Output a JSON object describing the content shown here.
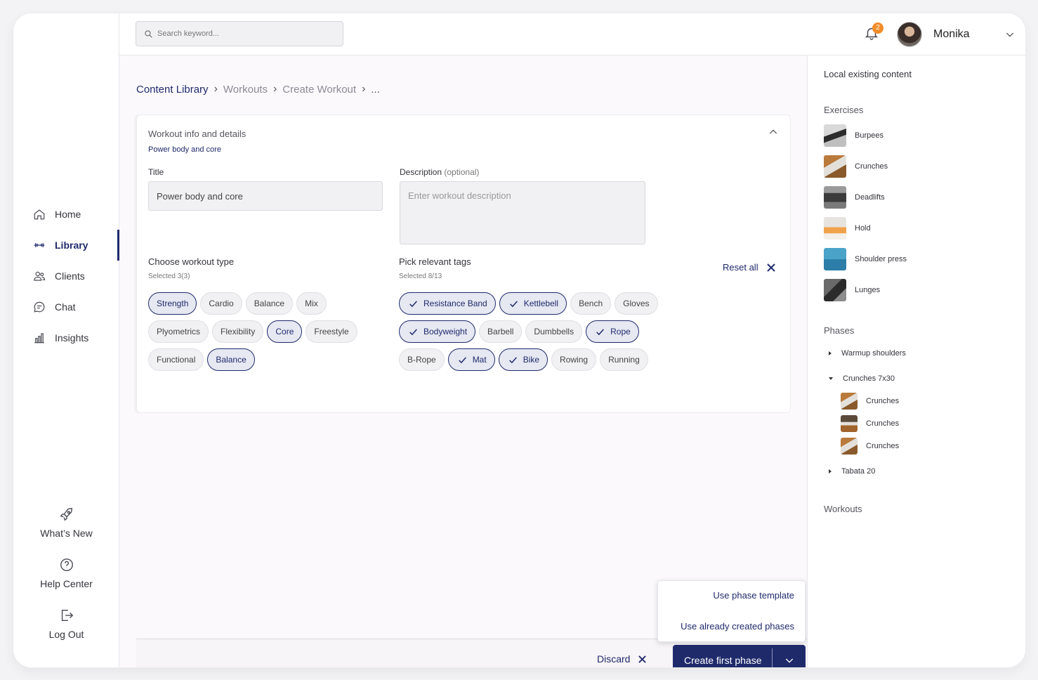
{
  "colors": {
    "accent": "#1f2a6b",
    "badge": "#f28c28"
  },
  "search": {
    "placeholder": "Search keyword..."
  },
  "header": {
    "notification_count": "2",
    "username": "Monika"
  },
  "nav": {
    "items": [
      {
        "label": "Home",
        "icon": "home-icon"
      },
      {
        "label": "Library",
        "icon": "dumbbell-icon",
        "active": true
      },
      {
        "label": "Clients",
        "icon": "users-icon"
      },
      {
        "label": "Chat",
        "icon": "chat-icon"
      },
      {
        "label": "Insights",
        "icon": "chart-icon"
      }
    ],
    "bottom": [
      {
        "label": "What’s New",
        "icon": "rocket-icon"
      },
      {
        "label": "Help Center",
        "icon": "help-icon"
      },
      {
        "label": "Log Out",
        "icon": "logout-icon"
      }
    ]
  },
  "breadcrumb": [
    "Content Library",
    "Workouts",
    "Create Workout",
    "..."
  ],
  "card": {
    "title": "Workout info and details",
    "subtitle": "Power body and core",
    "title_label": "Title",
    "title_value": "Power body and core",
    "desc_label": "Description",
    "desc_optional": "(optional)",
    "desc_placeholder": "Enter workout description",
    "type_title": "Choose workout type",
    "type_selected": "Selected 3(3)",
    "tags_title": "Pick relevant tags",
    "tags_selected": "Selected 8/13",
    "reset_label": "Reset all"
  },
  "workout_types": [
    {
      "label": "Strength",
      "selected": true
    },
    {
      "label": "Cardio",
      "selected": false
    },
    {
      "label": "Balance",
      "selected": false
    },
    {
      "label": "Mix",
      "selected": false
    },
    {
      "label": "Plyometrics",
      "selected": false
    },
    {
      "label": "Flexibility",
      "selected": false
    },
    {
      "label": "Core",
      "selected": true
    },
    {
      "label": "Freestyle",
      "selected": false
    },
    {
      "label": "Functional",
      "selected": false
    },
    {
      "label": "Balance",
      "selected": true
    }
  ],
  "tags": [
    {
      "label": "Resistance Band",
      "selected": true
    },
    {
      "label": "Kettlebell",
      "selected": true
    },
    {
      "label": "Bench",
      "selected": false
    },
    {
      "label": "Gloves",
      "selected": false
    },
    {
      "label": "Bodyweight",
      "selected": true
    },
    {
      "label": "Barbell",
      "selected": false
    },
    {
      "label": "Dumbbells",
      "selected": false
    },
    {
      "label": "Rope",
      "selected": true
    },
    {
      "label": "B-Rope",
      "selected": false
    },
    {
      "label": "Mat",
      "selected": true
    },
    {
      "label": "Bike",
      "selected": true
    },
    {
      "label": "Rowing",
      "selected": false
    },
    {
      "label": "Running",
      "selected": false
    }
  ],
  "actions": {
    "discard": "Discard",
    "primary": "Create first phase",
    "menu": [
      "Use phase template",
      "Use already created phases"
    ]
  },
  "panel": {
    "title": "Local existing content",
    "exercises_label": "Exercises",
    "exercises": [
      "Burpees",
      "Crunches",
      "Deadlifts",
      "Hold",
      "Shoulder press",
      "Lunges"
    ],
    "phases_label": "Phases",
    "phases": [
      {
        "label": "Warmup shoulders",
        "expanded": false
      },
      {
        "label": "Crunches 7x30",
        "expanded": true,
        "children": [
          "Crunches",
          "Crunches",
          "Crunches"
        ]
      },
      {
        "label": "Tabata 20",
        "expanded": false
      }
    ],
    "workouts_label": "Workouts"
  }
}
